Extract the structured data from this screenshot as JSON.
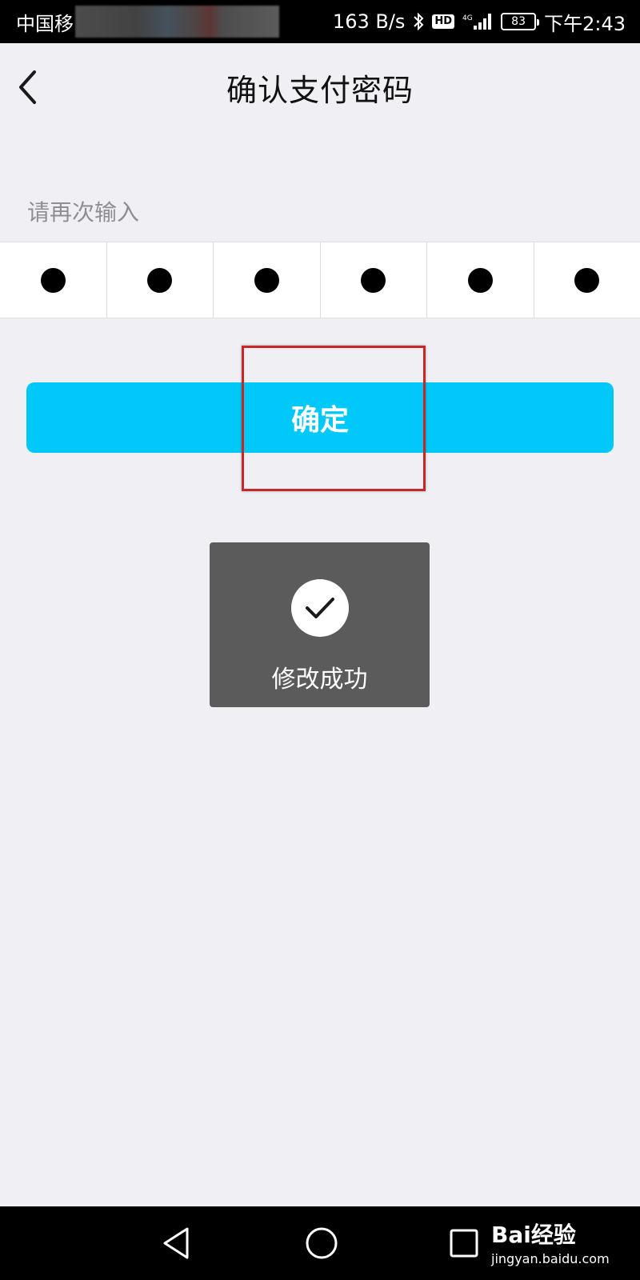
{
  "status_bar": {
    "carrier": "中国移",
    "net_speed": "163 B/s",
    "hd_badge": "HD",
    "signal_label": "4G",
    "battery": "83",
    "time": "下午2:43"
  },
  "header": {
    "title": "确认支付密码"
  },
  "prompt": "请再次输入",
  "password": {
    "length": 6,
    "filled": 6
  },
  "confirm_button": {
    "label": "确定",
    "color": "#00c8f8"
  },
  "toast": {
    "message": "修改成功"
  },
  "watermark": {
    "logo": "Bai经验",
    "url": "jingyan.baidu.com"
  },
  "colors": {
    "background": "#efeff4",
    "accent": "#00c8f8",
    "highlight": "#c62828",
    "toast_bg": "#5b5b5b"
  }
}
